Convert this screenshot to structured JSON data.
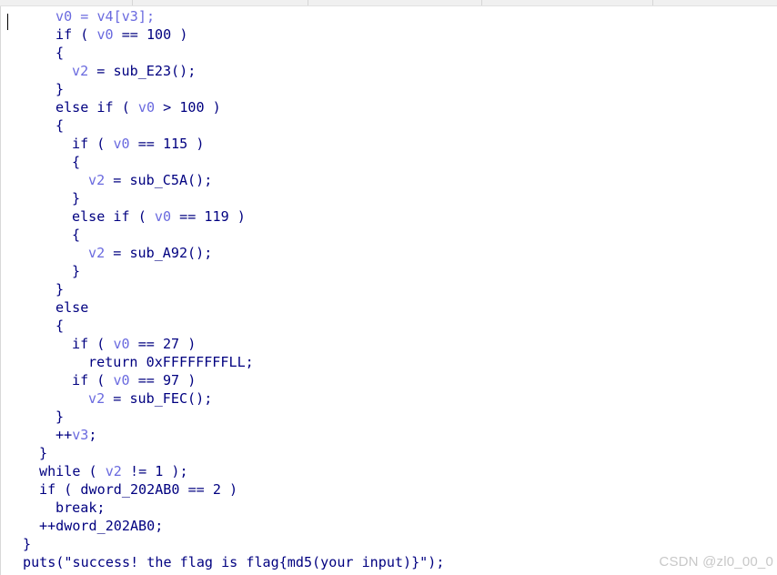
{
  "code": {
    "lines": [
      {
        "indent": 3,
        "tokens": [
          {
            "t": "v0",
            "k": "var"
          },
          {
            "t": " = ",
            "k": "var"
          },
          {
            "t": "v4[v3];",
            "k": "var"
          }
        ]
      },
      {
        "indent": 3,
        "tokens": [
          {
            "t": "if ( ",
            "k": "plain"
          },
          {
            "t": "v0",
            "k": "var"
          },
          {
            "t": " == 100 )",
            "k": "plain"
          }
        ]
      },
      {
        "indent": 3,
        "tokens": [
          {
            "t": "{",
            "k": "plain"
          }
        ]
      },
      {
        "indent": 4,
        "tokens": [
          {
            "t": "v2",
            "k": "var"
          },
          {
            "t": " = sub_E23();",
            "k": "plain"
          }
        ]
      },
      {
        "indent": 3,
        "tokens": [
          {
            "t": "}",
            "k": "plain"
          }
        ]
      },
      {
        "indent": 3,
        "tokens": [
          {
            "t": "else if ( ",
            "k": "plain"
          },
          {
            "t": "v0",
            "k": "var"
          },
          {
            "t": " > 100 )",
            "k": "plain"
          }
        ]
      },
      {
        "indent": 3,
        "tokens": [
          {
            "t": "{",
            "k": "plain"
          }
        ]
      },
      {
        "indent": 4,
        "tokens": [
          {
            "t": "if ( ",
            "k": "plain"
          },
          {
            "t": "v0",
            "k": "var"
          },
          {
            "t": " == 115 )",
            "k": "plain"
          }
        ]
      },
      {
        "indent": 4,
        "tokens": [
          {
            "t": "{",
            "k": "plain"
          }
        ]
      },
      {
        "indent": 5,
        "tokens": [
          {
            "t": "v2",
            "k": "var"
          },
          {
            "t": " = sub_C5A();",
            "k": "plain"
          }
        ]
      },
      {
        "indent": 4,
        "tokens": [
          {
            "t": "}",
            "k": "plain"
          }
        ]
      },
      {
        "indent": 4,
        "tokens": [
          {
            "t": "else if ( ",
            "k": "plain"
          },
          {
            "t": "v0",
            "k": "var"
          },
          {
            "t": " == 119 )",
            "k": "plain"
          }
        ]
      },
      {
        "indent": 4,
        "tokens": [
          {
            "t": "{",
            "k": "plain"
          }
        ]
      },
      {
        "indent": 5,
        "tokens": [
          {
            "t": "v2",
            "k": "var"
          },
          {
            "t": " = sub_A92();",
            "k": "plain"
          }
        ]
      },
      {
        "indent": 4,
        "tokens": [
          {
            "t": "}",
            "k": "plain"
          }
        ]
      },
      {
        "indent": 3,
        "tokens": [
          {
            "t": "}",
            "k": "plain"
          }
        ]
      },
      {
        "indent": 3,
        "tokens": [
          {
            "t": "else",
            "k": "plain"
          }
        ]
      },
      {
        "indent": 3,
        "tokens": [
          {
            "t": "{",
            "k": "plain"
          }
        ]
      },
      {
        "indent": 4,
        "tokens": [
          {
            "t": "if ( ",
            "k": "plain"
          },
          {
            "t": "v0",
            "k": "var"
          },
          {
            "t": " == 27 )",
            "k": "plain"
          }
        ]
      },
      {
        "indent": 5,
        "tokens": [
          {
            "t": "return 0xFFFFFFFFLL;",
            "k": "plain"
          }
        ]
      },
      {
        "indent": 4,
        "tokens": [
          {
            "t": "if ( ",
            "k": "plain"
          },
          {
            "t": "v0",
            "k": "var"
          },
          {
            "t": " == 97 )",
            "k": "plain"
          }
        ]
      },
      {
        "indent": 5,
        "tokens": [
          {
            "t": "v2",
            "k": "var"
          },
          {
            "t": " = sub_FEC();",
            "k": "plain"
          }
        ]
      },
      {
        "indent": 3,
        "tokens": [
          {
            "t": "}",
            "k": "plain"
          }
        ]
      },
      {
        "indent": 3,
        "tokens": [
          {
            "t": "++",
            "k": "plain"
          },
          {
            "t": "v3",
            "k": "var"
          },
          {
            "t": ";",
            "k": "plain"
          }
        ]
      },
      {
        "indent": 2,
        "tokens": [
          {
            "t": "}",
            "k": "plain"
          }
        ]
      },
      {
        "indent": 2,
        "tokens": [
          {
            "t": "while ( ",
            "k": "plain"
          },
          {
            "t": "v2",
            "k": "var"
          },
          {
            "t": " != 1 );",
            "k": "plain"
          }
        ]
      },
      {
        "indent": 2,
        "tokens": [
          {
            "t": "if ( dword_202AB0 == 2 )",
            "k": "plain"
          }
        ]
      },
      {
        "indent": 3,
        "tokens": [
          {
            "t": "break;",
            "k": "plain"
          }
        ]
      },
      {
        "indent": 2,
        "tokens": [
          {
            "t": "++dword_202AB0;",
            "k": "plain"
          }
        ]
      },
      {
        "indent": 1,
        "tokens": [
          {
            "t": "}",
            "k": "plain"
          }
        ]
      },
      {
        "indent": 1,
        "tokens": [
          {
            "t": "puts(\"success! the flag is flag{md5(your input)}\");",
            "k": "plain"
          }
        ]
      }
    ]
  },
  "colors": {
    "keyword_text": "#000080",
    "variable_text": "#6a6adf",
    "background": "#ffffff"
  },
  "watermark": {
    "text": "CSDN @zl0_00_0"
  }
}
